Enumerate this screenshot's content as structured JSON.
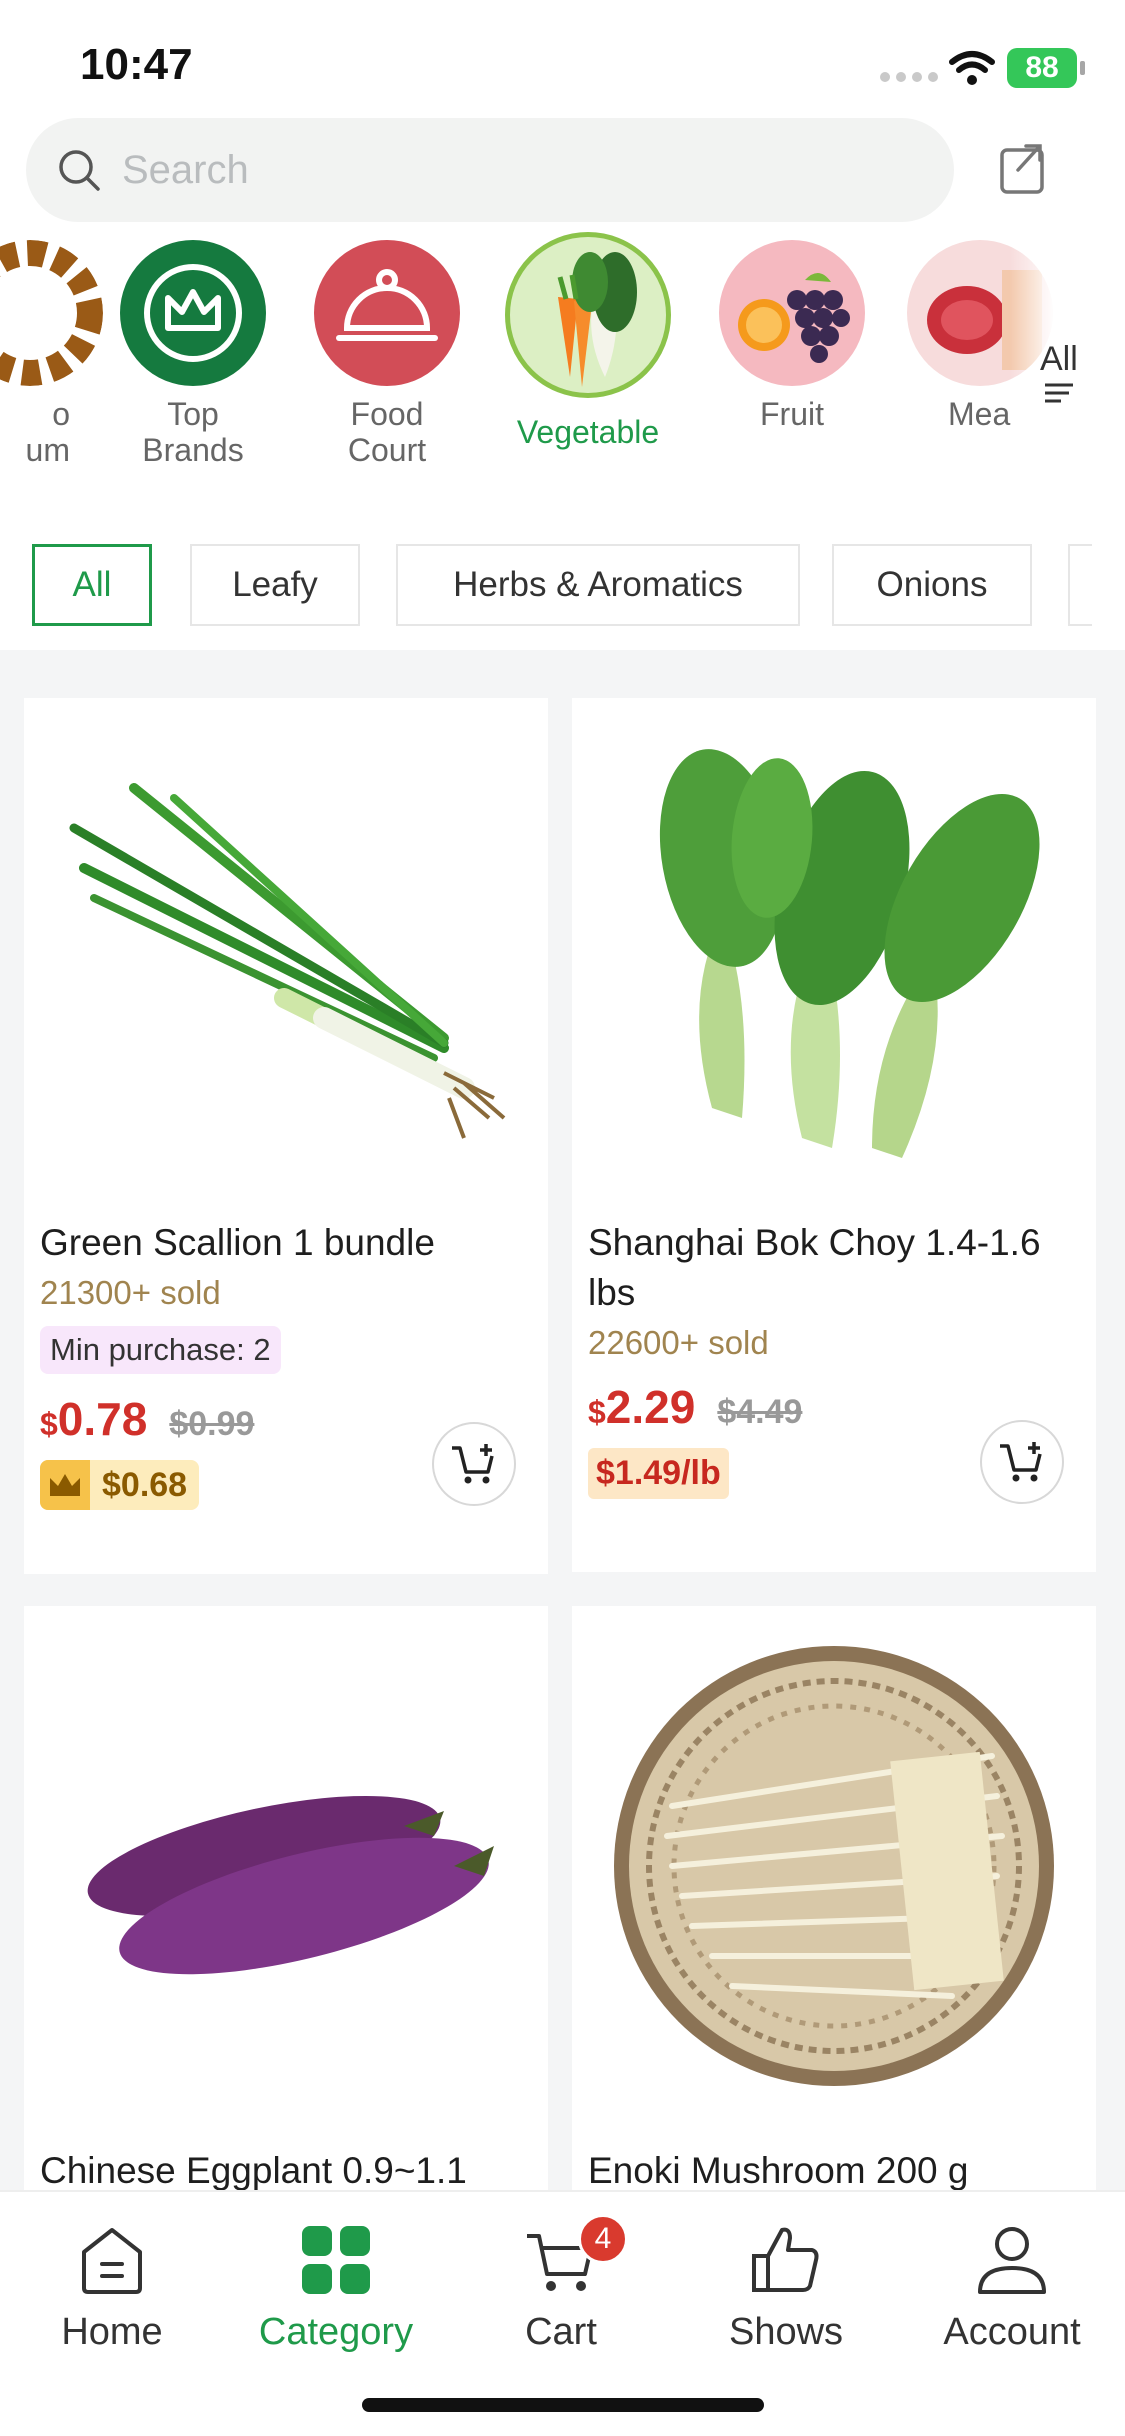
{
  "status_bar": {
    "time": "10:47",
    "battery": "88"
  },
  "search": {
    "placeholder": "Search"
  },
  "categories": [
    {
      "label": "o\num"
    },
    {
      "label": "Top\nBrands"
    },
    {
      "label": "Food\nCourt"
    },
    {
      "label": "Vegetable"
    },
    {
      "label": "Fruit"
    },
    {
      "label": "Mea"
    }
  ],
  "all_categories_label": "All",
  "chips": [
    "All",
    "Leafy",
    "Herbs & Aromatics",
    "Onions"
  ],
  "products": [
    {
      "name": "Green Scallion 1 bundle",
      "sold": "21300+ sold",
      "min_purchase": "Min purchase: 2",
      "currency": "$",
      "price": "0.78",
      "old_price": "$0.99",
      "vip_price": "$0.68"
    },
    {
      "name": "Shanghai Bok Choy 1.4-1.6 lbs",
      "sold": "22600+ sold",
      "currency": "$",
      "price": "2.29",
      "old_price": "$4.49",
      "per_lb": "$1.49/lb"
    },
    {
      "name": "Chinese Eggplant 0.9~1.1"
    },
    {
      "name": "Enoki Mushroom 200 g"
    }
  ],
  "tabs": [
    {
      "label": "Home"
    },
    {
      "label": "Category"
    },
    {
      "label": "Cart"
    },
    {
      "label": "Shows"
    },
    {
      "label": "Account"
    }
  ],
  "cart_badge": "4",
  "colors": {
    "accent": "#1f9a4a",
    "price": "#d0302a",
    "sold": "#a0844f"
  }
}
